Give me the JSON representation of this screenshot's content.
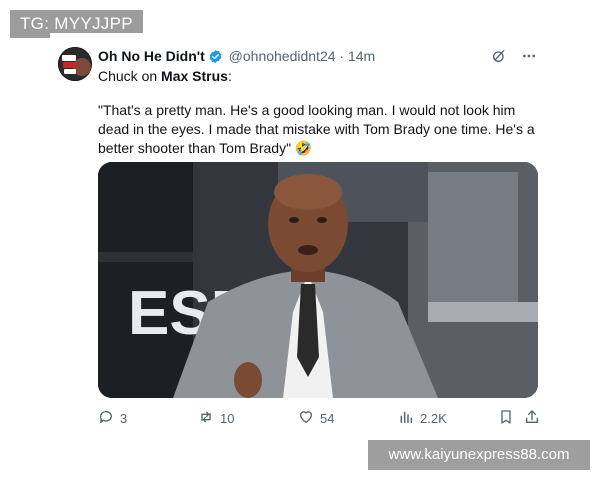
{
  "watermarks": {
    "top": "TG: MYYJJPP",
    "bottom": "www.kaiyunexpress88.com"
  },
  "tweet": {
    "author": {
      "display_name": "Oh No He Didn't",
      "handle": "@ohnohedidnt24",
      "verified": true,
      "avatar_text": "Oh No He Didn't"
    },
    "separator": "·",
    "time": "14m",
    "intro": {
      "prefix": "Chuck on ",
      "subject": "Max Strus",
      "suffix": ":"
    },
    "text": "\"That's a pretty man. He's a good looking man. I would not look him dead in the eyes. I made that mistake with Tom Brady one time. He's a better shooter than Tom Brady\" 🤣",
    "media": {
      "logo_text": "ESPN"
    },
    "stats": {
      "replies": "3",
      "reposts": "10",
      "likes": "54",
      "views": "2.2K"
    }
  },
  "icons": {
    "verified": "verified-badge-icon",
    "grok": "grok-icon",
    "more": "more-icon",
    "reply": "reply-icon",
    "repost": "repost-icon",
    "like": "heart-icon",
    "views": "views-icon",
    "bookmark": "bookmark-icon",
    "share": "share-icon"
  },
  "colors": {
    "verified_blue": "#1d9bf0",
    "text": "#0f1419",
    "muted": "#536471"
  }
}
